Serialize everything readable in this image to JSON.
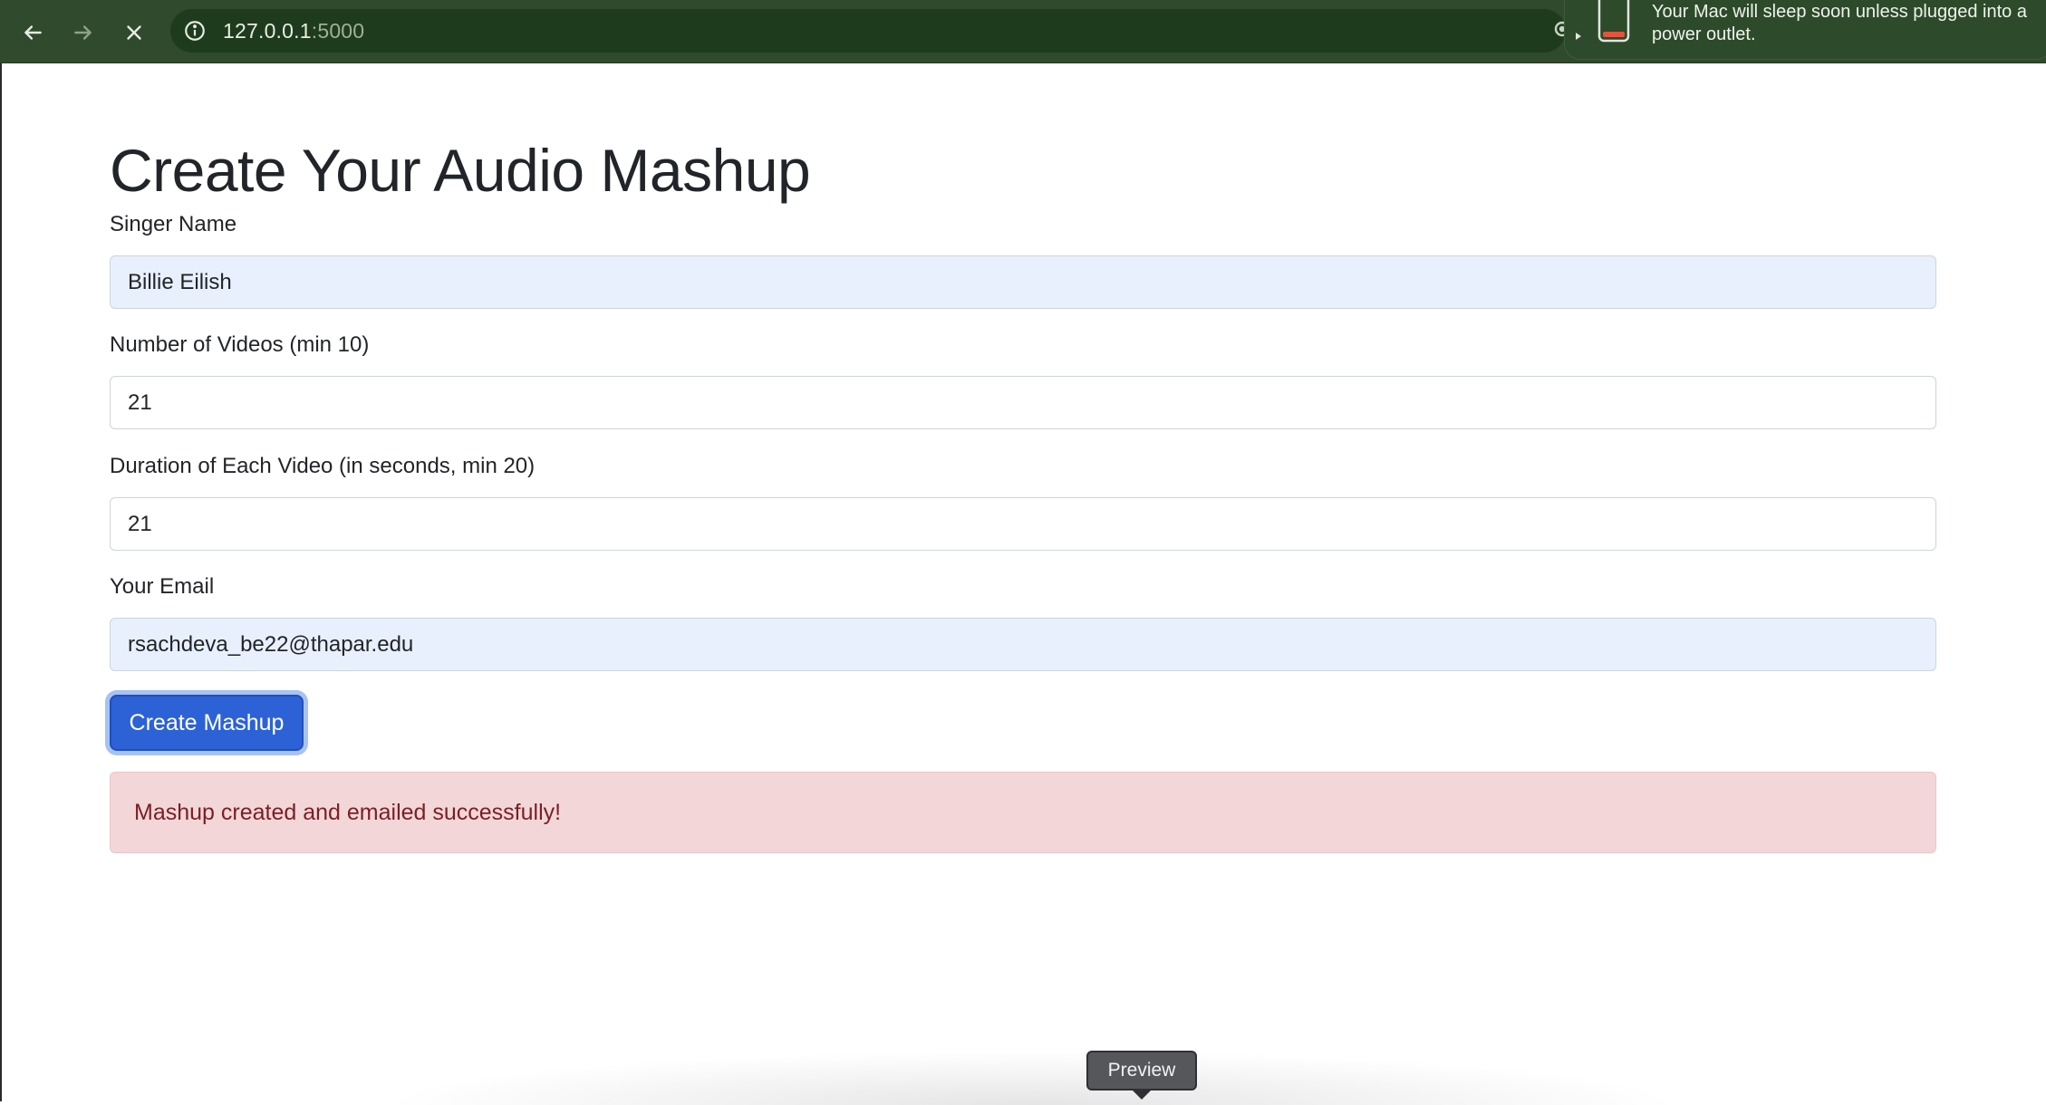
{
  "browser": {
    "url_host": "127.0.0.1",
    "url_port": ":5000",
    "theme_color": "#2f4a2c"
  },
  "notification": {
    "text": "Your Mac will sleep soon unless plugged into a power outlet.",
    "icon": "battery-low-icon"
  },
  "page": {
    "title": "Create Your Audio Mashup"
  },
  "form": {
    "singer": {
      "label": "Singer Name",
      "value": "Billie Eilish"
    },
    "videos": {
      "label": "Number of Videos (min 10)",
      "value": "21"
    },
    "duration": {
      "label": "Duration of Each Video (in seconds, min 20)",
      "value": "21"
    },
    "email": {
      "label": "Your Email",
      "value": "rsachdeva_be22@thapar.edu"
    },
    "submit_label": "Create Mashup"
  },
  "alert": {
    "message": "Mashup created and emailed successfully!"
  },
  "tooltip": {
    "label": "Preview"
  }
}
